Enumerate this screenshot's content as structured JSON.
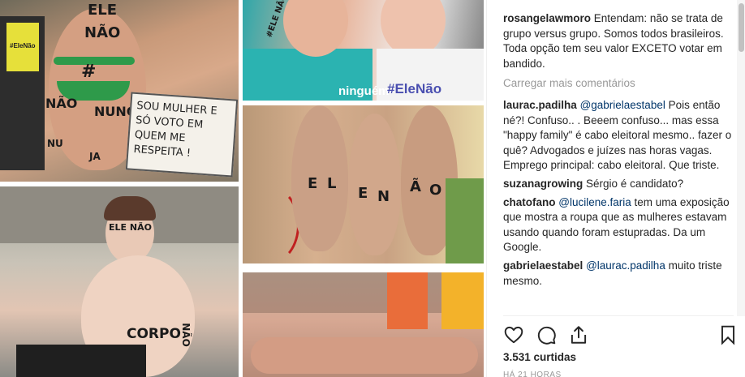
{
  "photos": {
    "tile1": {
      "paint_top": "ELE",
      "paint_mid": "NÃO",
      "paint_hash": "#",
      "paint_left": "NÃO",
      "paint_right": "NUNC",
      "paint_leg1": "NU",
      "paint_leg2": "JA",
      "shirt": "#EleNão",
      "sign_text": "SOU MULHER E SÓ VOTO EM QUEM ME RESPEITA !"
    },
    "tile2": {
      "cheek": "#ELE NÃO",
      "shirt_left": "ninguém",
      "shirt_right": "#EleNão"
    },
    "tile3": {
      "letters": [
        "E",
        "L",
        "E",
        "N",
        "Ã",
        "O"
      ]
    },
    "tile4": {
      "face": "ELE NÃO",
      "chest": "CORPO",
      "arm": "NÃO"
    }
  },
  "comments": [
    {
      "user": "rosangelawmoro",
      "text": "Entendam: não se trata de grupo versus grupo. Somos todos brasileiros. Toda opção tem seu valor EXCETO votar em bandido."
    },
    {
      "user": "laurac.padilha",
      "mention": "@gabrielaestabel",
      "text": "Pois então né?! Confuso.. . Beeem confuso... mas essa \"happy family\" é cabo eleitoral mesmo.. fazer o quê? Advogados e juízes nas horas vagas. Emprego principal: cabo eleitoral. Que triste."
    },
    {
      "user": "suzanagrowing",
      "text": "Sérgio é candidato?"
    },
    {
      "user": "chatofano",
      "mention": "@lucilene.faria",
      "text": "tem uma exposição que mostra a roupa que as mulheres estavam usando quando foram estupradas. Da um Google."
    },
    {
      "user": "gabrielaestabel",
      "mention": "@laurac.padilha",
      "text": "muito triste mesmo."
    }
  ],
  "load_more": "Carregar mais comentários",
  "likes": "3.531 curtidas",
  "timestamp": "HÁ 21 HORAS",
  "icons": {
    "like": "heart-icon",
    "comment": "comment-bubble-icon",
    "share": "share-icon",
    "save": "bookmark-icon"
  },
  "colors": {
    "text": "#262626",
    "mention": "#003569",
    "muted": "#999999"
  }
}
